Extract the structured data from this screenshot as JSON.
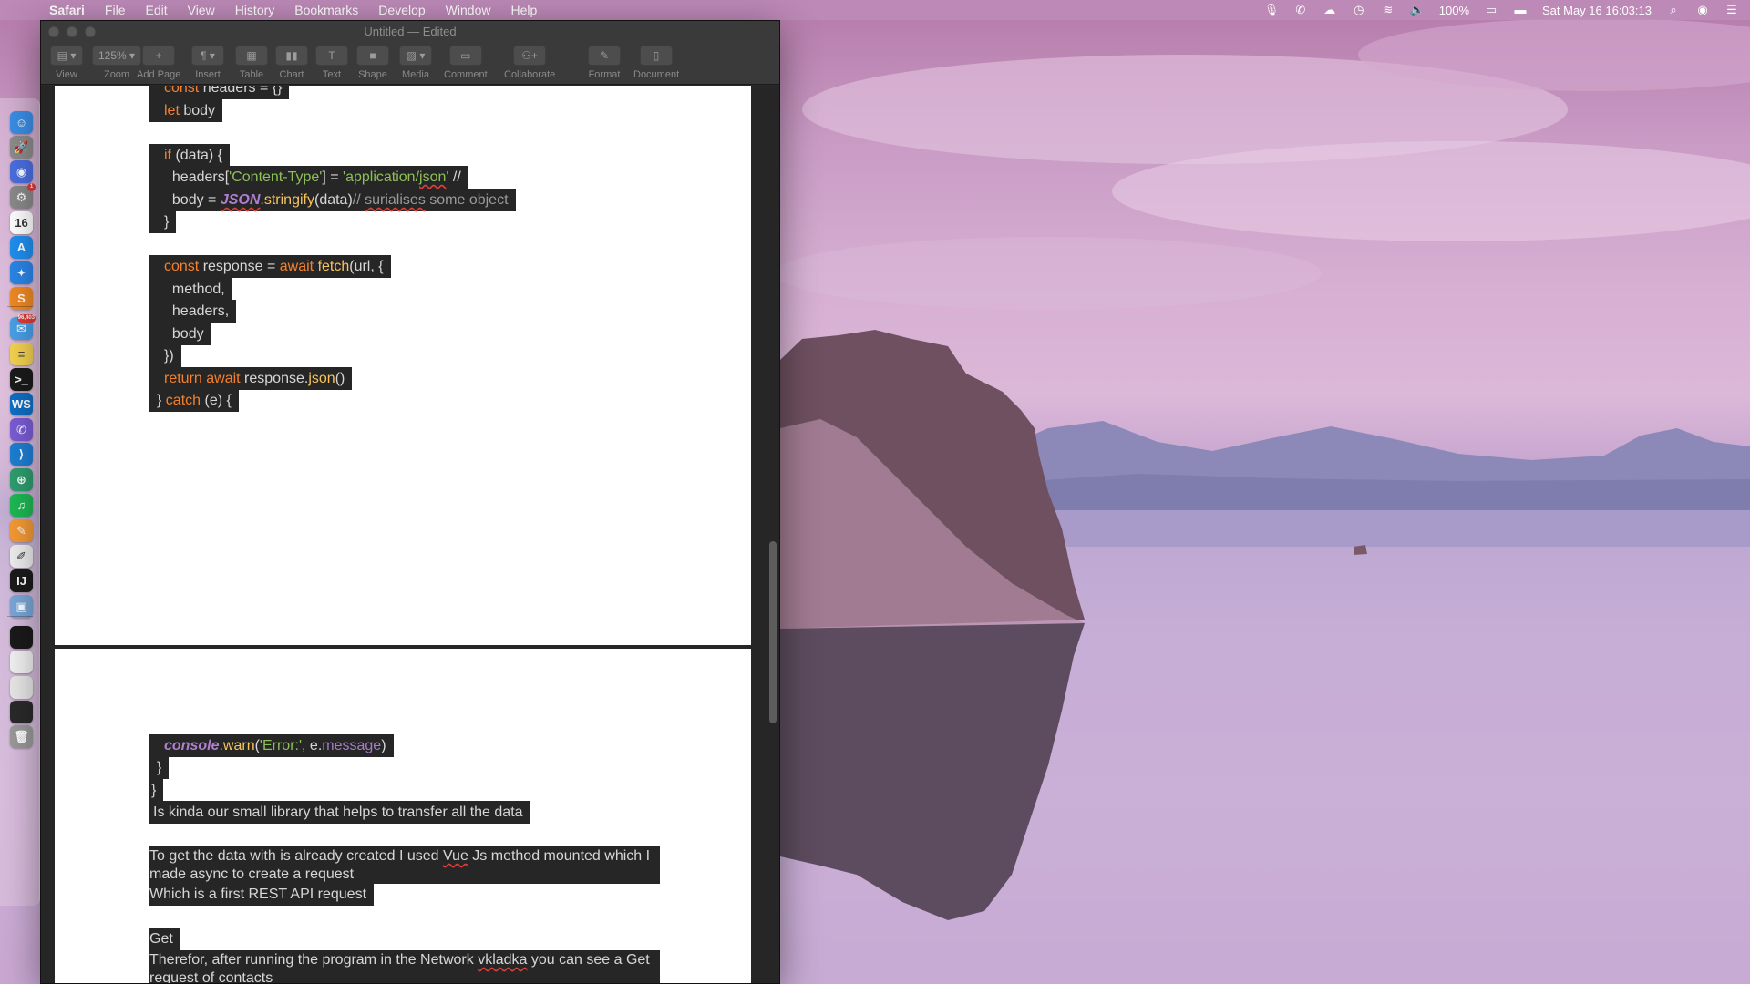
{
  "menubar": {
    "app": "Safari",
    "items": [
      "File",
      "Edit",
      "View",
      "History",
      "Bookmarks",
      "Develop",
      "Window",
      "Help"
    ],
    "battery": "100%",
    "datetime": "Sat May 16  16:03:13"
  },
  "dock": {
    "icons": [
      {
        "name": "finder-icon",
        "color": "#3a8ee6",
        "glyph": "☺"
      },
      {
        "name": "launchpad-icon",
        "color": "#8c8c8c",
        "glyph": "🚀"
      },
      {
        "name": "siri-icon",
        "color": "#4b6fe0",
        "glyph": "◉"
      },
      {
        "name": "system-preferences-icon",
        "color": "#8a8a8a",
        "glyph": "⚙",
        "badge": "1"
      },
      {
        "name": "calendar-icon",
        "color": "#ffffff",
        "glyph": "16"
      },
      {
        "name": "app-store-icon",
        "color": "#1f8ff0",
        "glyph": "A"
      },
      {
        "name": "safari-icon",
        "color": "#2a86e8",
        "glyph": "✦"
      },
      {
        "name": "sublime-text-icon",
        "color": "#f08a24",
        "glyph": "S"
      },
      {
        "name": "mail-icon",
        "color": "#4aa0e8",
        "glyph": "✉",
        "badge": "96,403"
      },
      {
        "name": "notes-icon",
        "color": "#f5d250",
        "glyph": "≡"
      },
      {
        "name": "terminal-icon",
        "color": "#1b1b1b",
        "glyph": ">_"
      },
      {
        "name": "webstorm-icon",
        "color": "#0f6fc4",
        "glyph": "WS"
      },
      {
        "name": "viber-icon",
        "color": "#7b5cd6",
        "glyph": "✆"
      },
      {
        "name": "vscode-icon",
        "color": "#1e7fd4",
        "glyph": "⟩"
      },
      {
        "name": "network-icon",
        "color": "#2e9e6f",
        "glyph": "⊕"
      },
      {
        "name": "spotify-icon",
        "color": "#1db954",
        "glyph": "♫"
      },
      {
        "name": "pages-icon",
        "color": "#f59a35",
        "glyph": "✎"
      },
      {
        "name": "textedit-icon",
        "color": "#eeeeee",
        "glyph": "✐"
      },
      {
        "name": "intellij-icon",
        "color": "#1b1b1b",
        "glyph": "IJ"
      },
      {
        "name": "preview-icon",
        "color": "#7aa7d8",
        "glyph": "▣"
      },
      {
        "name": "minimized-window-1-icon",
        "color": "#1a1a1a",
        "glyph": ""
      },
      {
        "name": "minimized-window-2-icon",
        "color": "#f2f2f2",
        "glyph": ""
      },
      {
        "name": "minimized-window-3-icon",
        "color": "#e8e8e8",
        "glyph": ""
      },
      {
        "name": "minimized-window-4-icon",
        "color": "#2a2a2a",
        "glyph": ""
      },
      {
        "name": "trash-icon",
        "color": "#9a9a9a",
        "glyph": "🗑"
      }
    ]
  },
  "window": {
    "title": "Untitled — Edited",
    "toolbar": [
      {
        "name": "view",
        "label": "View",
        "glyph": "▤ ▾"
      },
      {
        "name": "zoom",
        "label": "Zoom",
        "glyph": "125% ▾"
      },
      {
        "name": "add-page",
        "label": "Add Page",
        "glyph": "+"
      },
      {
        "name": "insert",
        "label": "Insert",
        "glyph": "¶ ▾"
      },
      {
        "name": "table",
        "label": "Table",
        "glyph": "▦"
      },
      {
        "name": "chart",
        "label": "Chart",
        "glyph": "▮▮"
      },
      {
        "name": "text",
        "label": "Text",
        "glyph": "T"
      },
      {
        "name": "shape",
        "label": "Shape",
        "glyph": "■"
      },
      {
        "name": "media",
        "label": "Media",
        "glyph": "▨ ▾"
      },
      {
        "name": "comment",
        "label": "Comment",
        "glyph": "▭"
      },
      {
        "name": "collaborate",
        "label": "Collaborate",
        "glyph": "⚇+"
      },
      {
        "name": "format",
        "label": "Format",
        "glyph": "✎"
      },
      {
        "name": "document",
        "label": "Document",
        "glyph": "▯"
      }
    ]
  },
  "document": {
    "page1": [
      [
        {
          "t": "const",
          "c": "k"
        },
        {
          "t": " headers = {}"
        }
      ],
      [
        {
          "t": "let",
          "c": "k"
        },
        {
          "t": " body"
        }
      ],
      [
        {
          "t": "if",
          "c": "k"
        },
        {
          "t": " (data) {"
        }
      ],
      [
        {
          "t": "  headers["
        },
        {
          "t": "'Content-Type'",
          "c": "s"
        },
        {
          "t": "] = "
        },
        {
          "t": "'application/",
          "c": "s"
        },
        {
          "t": "json",
          "c": "s err"
        },
        {
          "t": "'",
          "c": "s"
        },
        {
          "t": " //"
        }
      ],
      [
        {
          "t": "  body = "
        },
        {
          "t": "JSON",
          "c": "o err"
        },
        {
          "t": ".stringify",
          "c": "f"
        },
        {
          "t": "(data)"
        },
        {
          "t": "// ",
          "c": "c"
        },
        {
          "t": "surialises",
          "c": "c err"
        },
        {
          "t": " some object",
          "c": "c"
        }
      ],
      [
        {
          "t": "}"
        }
      ],
      [
        {
          "t": "const",
          "c": "k"
        },
        {
          "t": " response = "
        },
        {
          "t": "await",
          "c": "k"
        },
        {
          "t": " "
        },
        {
          "t": "fetch",
          "c": "f"
        },
        {
          "t": "(url, {"
        }
      ],
      [
        {
          "t": "  method,"
        }
      ],
      [
        {
          "t": "  headers,"
        }
      ],
      [
        {
          "t": "  body"
        }
      ],
      [
        {
          "t": "})"
        }
      ],
      [
        {
          "t": "return",
          "c": "k"
        },
        {
          "t": " "
        },
        {
          "t": "await",
          "c": "k"
        },
        {
          "t": " response."
        },
        {
          "t": "json",
          "c": "f"
        },
        {
          "t": "()"
        }
      ],
      [
        {
          "t": "} "
        },
        {
          "t": "catch",
          "c": "k"
        },
        {
          "t": " (e) {"
        }
      ]
    ],
    "page2": [
      [
        {
          "t": "console",
          "c": "o"
        },
        {
          "t": ".warn",
          "c": "f"
        },
        {
          "t": "("
        },
        {
          "t": "'Error:'",
          "c": "s"
        },
        {
          "t": ", e."
        },
        {
          "t": "message",
          "c": "p"
        },
        {
          "t": ")"
        }
      ],
      [
        {
          "t": "}"
        }
      ],
      [
        {
          "t": "}"
        }
      ],
      [
        {
          "t": "Is kinda our small library that helps to transfer all the data"
        }
      ],
      [
        {
          "t": "To get the data with is already created I used "
        },
        {
          "t": "Vue",
          "c": "err"
        },
        {
          "t": " Js method mounted which I made async to create a request"
        }
      ],
      [
        {
          "t": "Which is a first REST API request"
        }
      ],
      [
        {
          "t": "Get"
        }
      ],
      [
        {
          "t": "Therefor, after running the program in the Network "
        },
        {
          "t": "vkladka",
          "c": "err"
        },
        {
          "t": " you can see a Get request of contacts"
        }
      ]
    ]
  }
}
